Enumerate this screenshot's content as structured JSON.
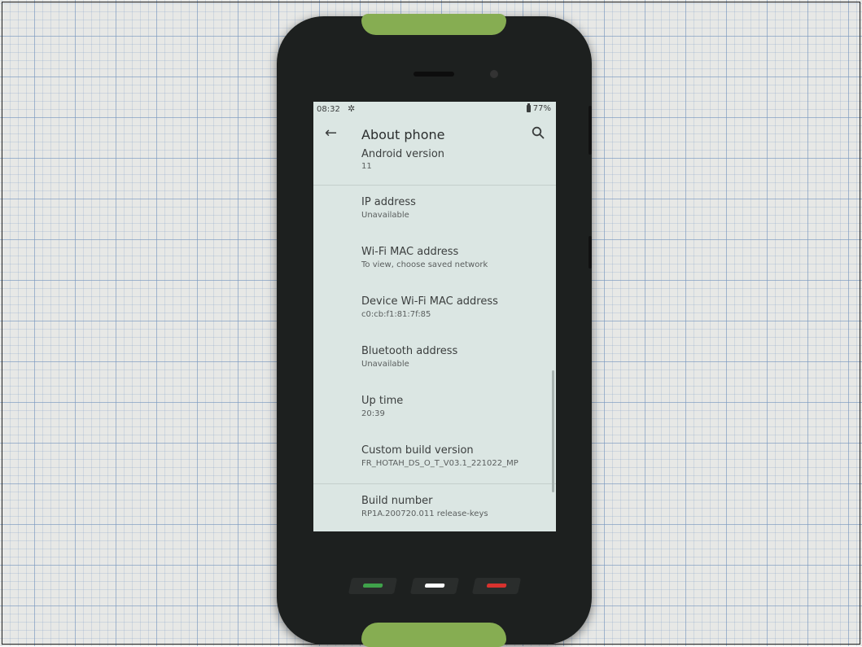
{
  "status_bar": {
    "time": "08:32",
    "settings_icon": "gear-icon",
    "battery_icon": "battery-icon",
    "battery_percent": "77%"
  },
  "app_bar": {
    "back_icon": "arrow-left-icon",
    "title": "About phone",
    "search_icon": "search-icon"
  },
  "items": [
    {
      "title": "Android version",
      "summary": "11"
    },
    {
      "title": "IP address",
      "summary": "Unavailable"
    },
    {
      "title": "Wi-Fi MAC address",
      "summary": "To view, choose saved network"
    },
    {
      "title": "Device Wi-Fi MAC address",
      "summary": "c0:cb:f1:81:7f:85"
    },
    {
      "title": "Bluetooth address",
      "summary": "Unavailable"
    },
    {
      "title": "Up time",
      "summary": "20:39"
    },
    {
      "title": "Custom build version",
      "summary": "FR_HOTAH_DS_O_T_V03.1_221022_MP"
    },
    {
      "title": "Build number",
      "summary": "RP1A.200720.011 release-keys"
    }
  ],
  "colors": {
    "screen_background": "#dbe6e3",
    "phone_body": "#1d201f",
    "bumper_accent": "#86ad52",
    "call_key": "#3fa24a",
    "home_key": "#ffffff",
    "end_call_key": "#d8322e"
  }
}
